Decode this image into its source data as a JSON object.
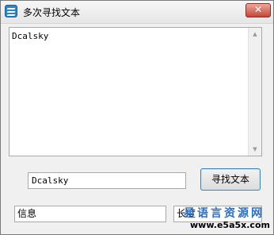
{
  "window": {
    "title": "多次寻找文本",
    "close_label": "✕",
    "icon": "app-icon"
  },
  "memo": {
    "text": "Dcalsky"
  },
  "search": {
    "value": "Dcalsky"
  },
  "find_button": {
    "label": "寻找文本"
  },
  "info": {
    "value": "信息"
  },
  "length": {
    "value": "长度"
  },
  "watermark": {
    "line1": "易语言资源网",
    "line2": "www.e5a5x.com"
  }
}
